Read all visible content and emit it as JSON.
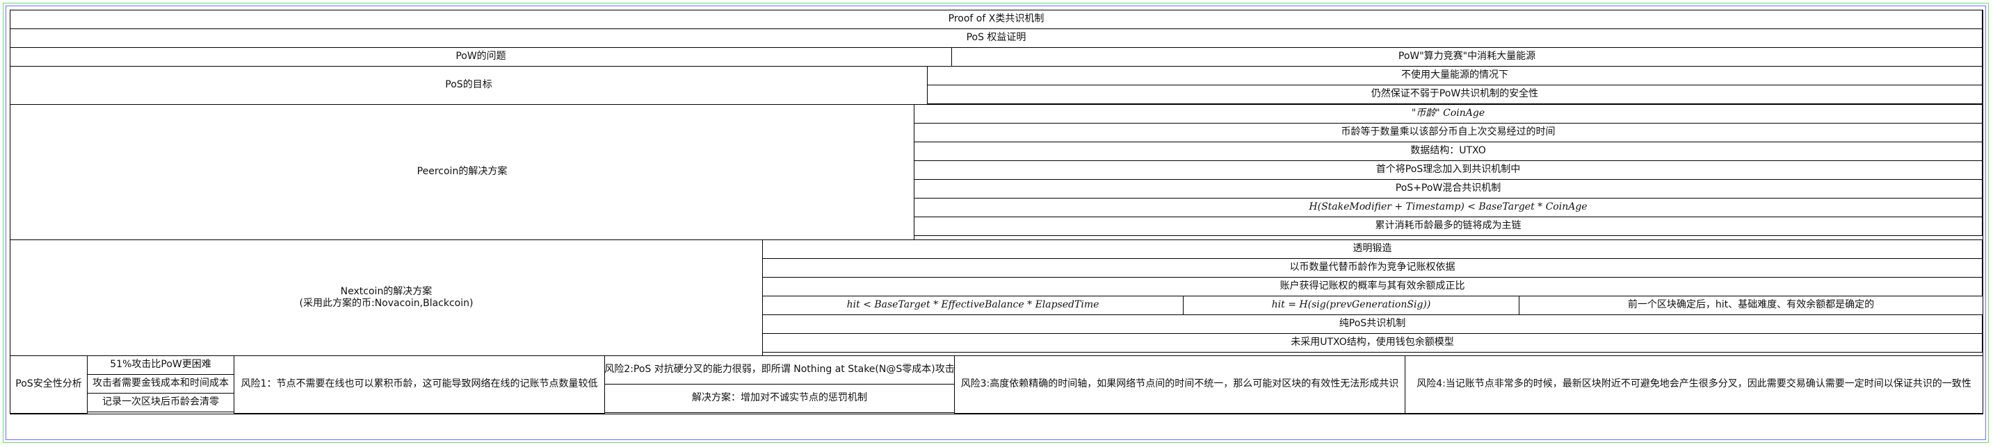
{
  "title": "Proof of X类共识机制",
  "pos_header": "PoS 权益证明",
  "pow_problem": {
    "label": "PoW的问题",
    "value": "PoW\"算力竞赛\"中消耗大量能源"
  },
  "pos_goal": {
    "label": "PoS的目标",
    "items": [
      "不使用大量能源的情况下",
      "仍然保证不弱于PoW共识机制的安全性"
    ]
  },
  "peercoin": {
    "label": "Peercoin的解决方案",
    "items": [
      "\"币龄\" CoinAge",
      "币龄等于数量乘以该部分币自上次交易经过的时间",
      "数据结构：UTXO",
      "首个将PoS理念加入到共识机制中",
      "PoS+PoW混合共识机制",
      "H(StakeModifier + Timestamp) < BaseTarget * CoinAge",
      "累计消耗币龄最多的链将成为主链"
    ]
  },
  "nextcoin": {
    "label": "Nextcoin的解决方案",
    "sublabel": "(采用此方案的币:Novacoin,Blackcoin)",
    "items": [
      "透明锻造",
      "以币数量代替币龄作为竞争记账权依据",
      "账户获得记账权的概率与其有效余额成正比"
    ],
    "hit_row": [
      "hit < BaseTarget * EffectiveBalance * ElapsedTime",
      "hit = H(sig(prevGenerationSig))",
      "前一个区块确定后，hit、基础难度、有效余额都是确定的"
    ],
    "items_after": [
      "纯PoS共识机制",
      "未采用UTXO结构，使用钱包余额模型"
    ]
  },
  "security": {
    "label": "PoS安全性分析",
    "sub_items": [
      "51%攻击比PoW更困难",
      "攻击者需要金钱成本和时间成本",
      "记录一次区块后币龄会清零"
    ],
    "risk1": "风险1：节点不需要在线也可以累积币龄，这可能导致网络在线的记账节点数量较低",
    "risk2": "风险2:PoS 对抗硬分叉的能力很弱，即所谓 Nothing at Stake(N@S零成本)攻击",
    "risk2_solution": "解决方案：增加对不诚实节点的惩罚机制",
    "risk3": "风险3:高度依赖精确的时间轴，如果网络节点间的时间不统一，那么可能对区块的有效性无法形成共识",
    "risk4": "风险4:当记账节点非常多的时候，最新区块附近不可避免地会产生很多分叉，因此需要交易确认需要一定时间以保证共识的一致性"
  }
}
